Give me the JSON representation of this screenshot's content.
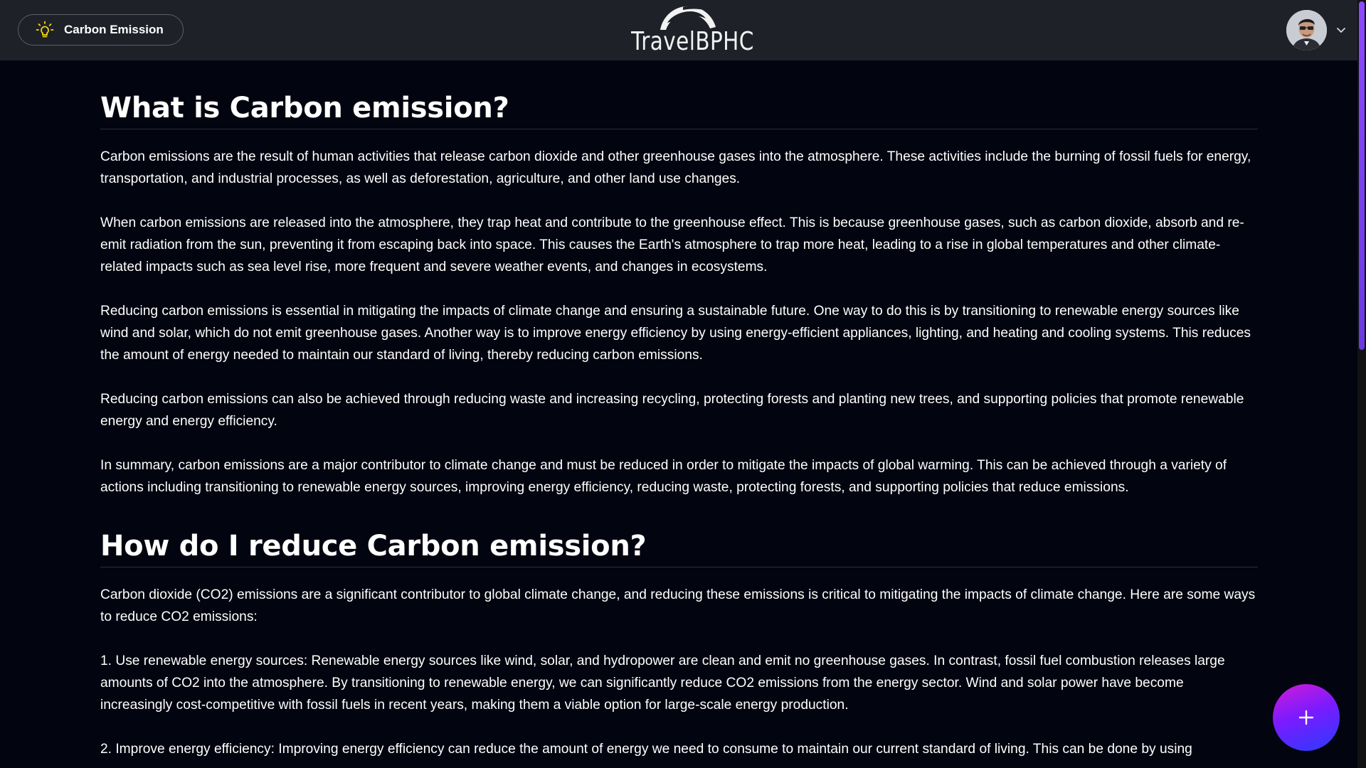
{
  "header": {
    "category_button_label": "Carbon Emission",
    "category_icon": "lightbulb-icon",
    "logo_text": "TravelBPHC",
    "avatar_icon": "user-avatar",
    "menu_icon": "chevron-down-icon"
  },
  "sections": [
    {
      "title": "What is Carbon emission?",
      "paragraphs": [
        "Carbon emissions are the result of human activities that release carbon dioxide and other greenhouse gases into the atmosphere. These activities include the burning of fossil fuels for energy, transportation, and industrial processes, as well as deforestation, agriculture, and other land use changes.",
        "When carbon emissions are released into the atmosphere, they trap heat and contribute to the greenhouse effect. This is because greenhouse gases, such as carbon dioxide, absorb and re-emit radiation from the sun, preventing it from escaping back into space. This causes the Earth's atmosphere to trap more heat, leading to a rise in global temperatures and other climate-related impacts such as sea level rise, more frequent and severe weather events, and changes in ecosystems.",
        "Reducing carbon emissions is essential in mitigating the impacts of climate change and ensuring a sustainable future. One way to do this is by transitioning to renewable energy sources like wind and solar, which do not emit greenhouse gases. Another way is to improve energy efficiency by using energy-efficient appliances, lighting, and heating and cooling systems. This reduces the amount of energy needed to maintain our standard of living, thereby reducing carbon emissions.",
        "Reducing carbon emissions can also be achieved through reducing waste and increasing recycling, protecting forests and planting new trees, and supporting policies that promote renewable energy and energy efficiency.",
        "In summary, carbon emissions are a major contributor to climate change and must be reduced in order to mitigate the impacts of global warming. This can be achieved through a variety of actions including transitioning to renewable energy sources, improving energy efficiency, reducing waste, protecting forests, and supporting policies that reduce emissions."
      ]
    },
    {
      "title": "How do I reduce Carbon emission?",
      "paragraphs": [
        "Carbon dioxide (CO2) emissions are a significant contributor to global climate change, and reducing these emissions is critical to mitigating the impacts of climate change. Here are some ways to reduce CO2 emissions:",
        "1. Use renewable energy sources: Renewable energy sources like wind, solar, and hydropower are clean and emit no greenhouse gases. In contrast, fossil fuel combustion releases large amounts of CO2 into the atmosphere. By transitioning to renewable energy, we can significantly reduce CO2 emissions from the energy sector. Wind and solar power have become increasingly cost-competitive with fossil fuels in recent years, making them a viable option for large-scale energy production.",
        "2. Improve energy efficiency: Improving energy efficiency can reduce the amount of energy we need to consume to maintain our current standard of living. This can be done by using"
      ]
    }
  ],
  "fab": {
    "icon": "plus-icon"
  },
  "colors": {
    "page_background": "#02040f",
    "navbar_background": "#1e2128",
    "scrollbar_thumb": "#8d49ff",
    "fab_gradient_start": "#d21bd6",
    "fab_gradient_end": "#2a3cff",
    "bulb_yellow": "#f5d90a"
  }
}
